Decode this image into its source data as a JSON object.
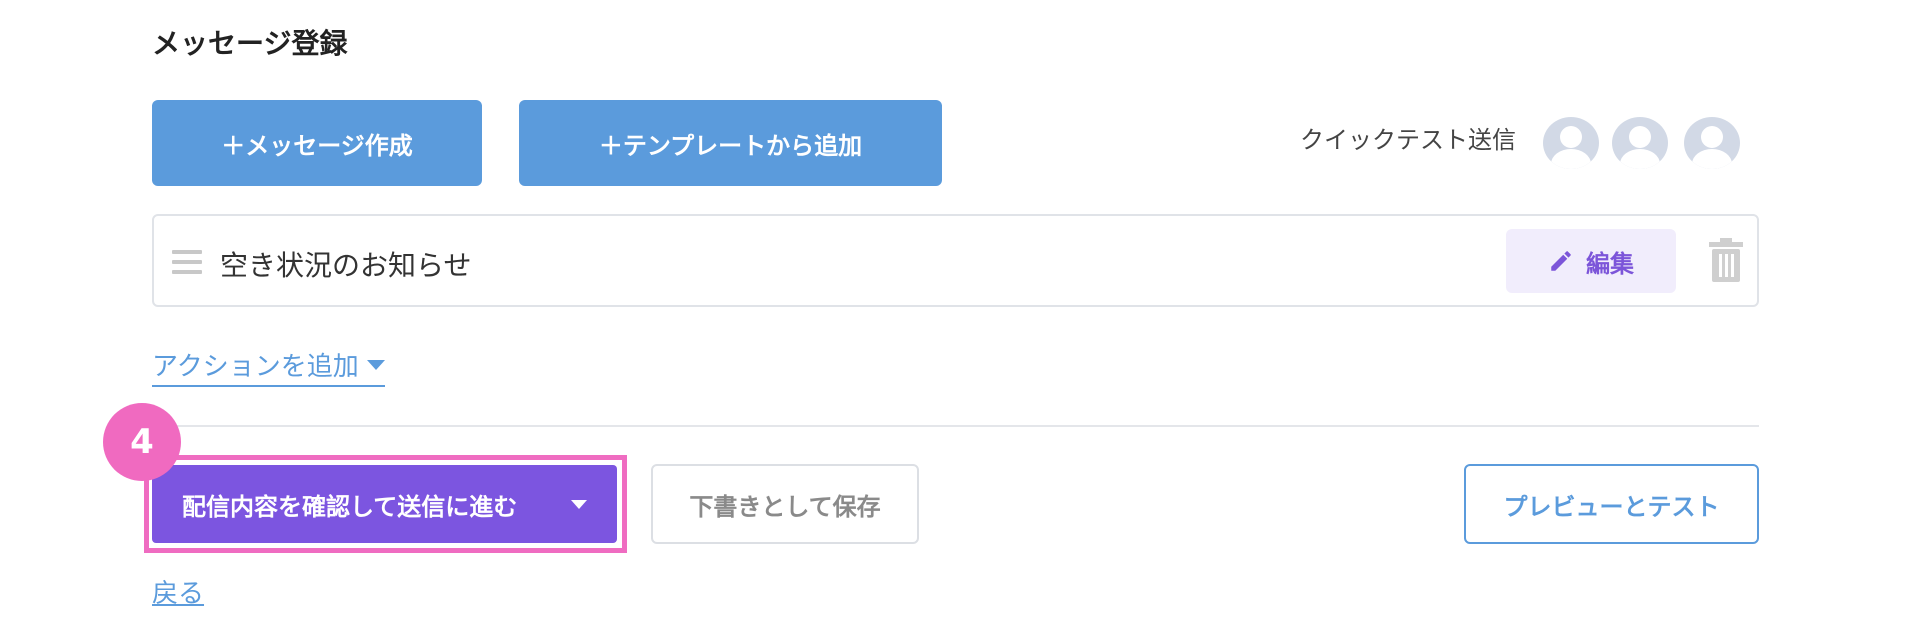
{
  "page": {
    "title": "メッセージ登録"
  },
  "toolbar": {
    "create_label": "＋メッセージ作成",
    "template_label": "＋テンプレートから追加",
    "quick_test_label": "クイックテスト送信"
  },
  "message": {
    "title": "空き状況のお知らせ",
    "edit_label": "編集"
  },
  "actions": {
    "add_action_label": "アクションを追加"
  },
  "footer": {
    "step_number": "4",
    "submit_label": "配信内容を確認して送信に進む",
    "draft_label": "下書きとして保存",
    "preview_label": "プレビューとテスト",
    "back_label": "戻る"
  },
  "colors": {
    "primary_blue": "#5b9bdc",
    "purple": "#7c55e0",
    "highlight_pink": "#ef6cc1",
    "edit_bg": "#f1edfc"
  },
  "icons": [
    "plus-icon",
    "avatar-icon",
    "drag-handle-icon",
    "pencil-icon",
    "trash-icon",
    "caret-down-icon"
  ]
}
